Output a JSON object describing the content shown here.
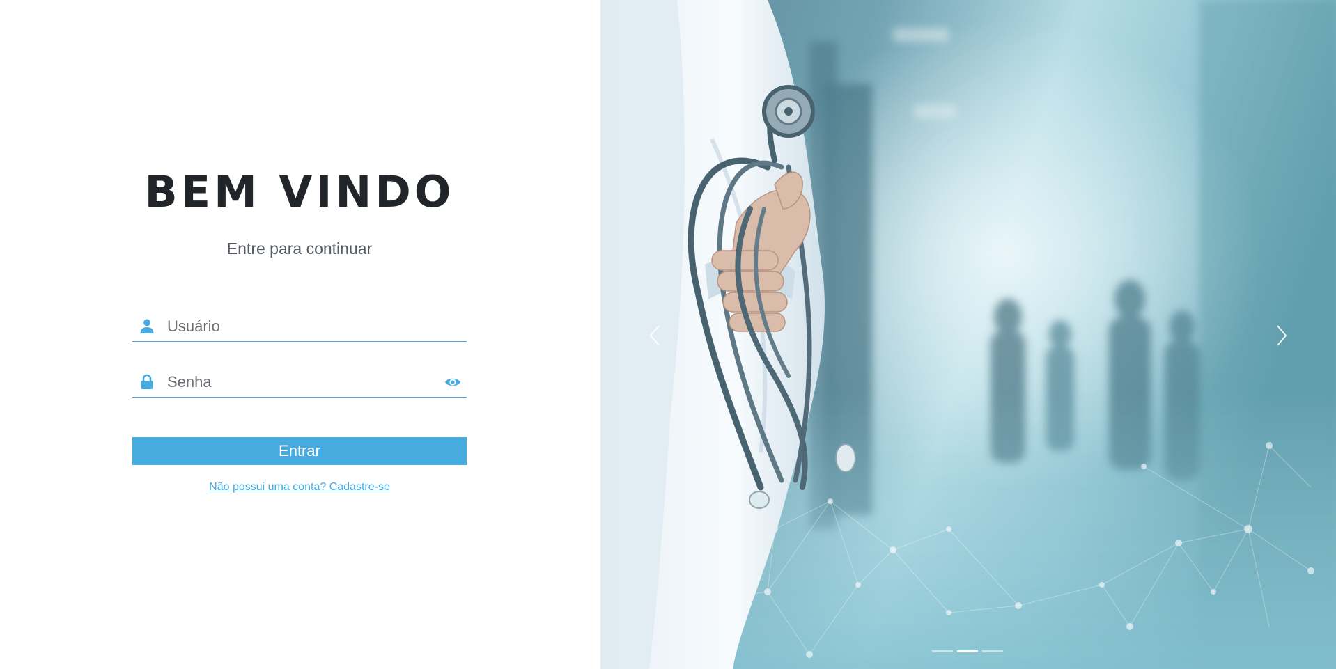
{
  "login": {
    "title": "BEM VINDO",
    "subtitle": "Entre para continuar",
    "username": {
      "placeholder": "Usuário",
      "value": "",
      "icon": "user-icon"
    },
    "password": {
      "placeholder": "Senha",
      "value": "",
      "icon": "lock-icon",
      "toggle_icon": "eye-icon"
    },
    "submit_label": "Entrar",
    "signup_link": "Não possui uma conta? Cadastre-se"
  },
  "carousel": {
    "image": "doctor-with-stethoscope-in-hospital-corridor",
    "prev_icon": "chevron-left-icon",
    "next_icon": "chevron-right-icon",
    "slide_count": 3,
    "active_slide": 2
  },
  "colors": {
    "accent": "#48abe0",
    "title": "#212529",
    "subtitle": "#555b61",
    "background": "#ffffff"
  }
}
